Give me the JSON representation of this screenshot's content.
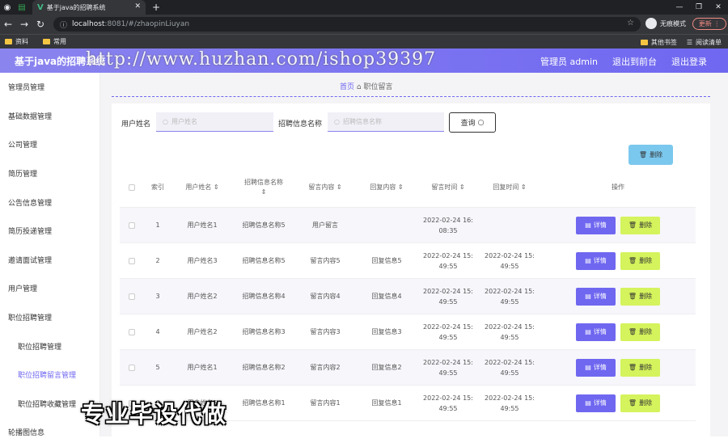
{
  "browser": {
    "tab_title": "基于java的招聘系统",
    "url_host": "localhost",
    "url_path": ":8081/#/zhaopinLiuyan",
    "incognito": "无痕模式",
    "update": "更新",
    "bookmarks": [
      "资料",
      "常用"
    ],
    "bookmarks_right": [
      "其他书签",
      "阅读清单"
    ]
  },
  "header": {
    "title": "基于java的招聘系统",
    "watermark": "http://www.huzhan.com/ishop39397",
    "links": [
      "管理员 admin",
      "退出到前台",
      "退出登录"
    ]
  },
  "sidebar": {
    "items": [
      {
        "label": "管理员管理",
        "sub": false,
        "active": false
      },
      {
        "label": "基础数据管理",
        "sub": false,
        "active": false
      },
      {
        "label": "公司管理",
        "sub": false,
        "active": false
      },
      {
        "label": "简历管理",
        "sub": false,
        "active": false
      },
      {
        "label": "公告信息管理",
        "sub": false,
        "active": false
      },
      {
        "label": "简历投递管理",
        "sub": false,
        "active": false
      },
      {
        "label": "邀请面试管理",
        "sub": false,
        "active": false
      },
      {
        "label": "用户管理",
        "sub": false,
        "active": false
      },
      {
        "label": "职位招聘管理",
        "sub": false,
        "active": false
      },
      {
        "label": "职位招聘管理",
        "sub": true,
        "active": false
      },
      {
        "label": "职位招聘留言管理",
        "sub": true,
        "active": true
      },
      {
        "label": "职位招聘收藏管理",
        "sub": true,
        "active": false
      },
      {
        "label": "轮播图信息",
        "sub": false,
        "active": false
      }
    ]
  },
  "breadcrumb": {
    "home": "首页",
    "current": "职位留言"
  },
  "search": {
    "user_label": "用户姓名",
    "user_placeholder": "用户姓名",
    "job_label": "招聘信息名称",
    "job_placeholder": "招聘信息名称",
    "query": "查询"
  },
  "delete_all": "删除",
  "table": {
    "headers": [
      "索引",
      "用户姓名",
      "招聘信息名称",
      "留言内容",
      "回复内容",
      "留言时间",
      "回复时间",
      "操作"
    ],
    "rows": [
      [
        "1",
        "用户姓名1",
        "招聘信息名称5",
        "用户留言",
        "",
        "2022-02-24 16:08:35",
        ""
      ],
      [
        "2",
        "用户姓名3",
        "招聘信息名称5",
        "留言内容5",
        "回复信息5",
        "2022-02-24 15:49:55",
        "2022-02-24 15:49:55"
      ],
      [
        "3",
        "用户姓名2",
        "招聘信息名称4",
        "留言内容4",
        "回复信息4",
        "2022-02-24 15:49:55",
        "2022-02-24 15:49:55"
      ],
      [
        "4",
        "用户姓名2",
        "招聘信息名称3",
        "留言内容3",
        "回复信息3",
        "2022-02-24 15:49:55",
        "2022-02-24 15:49:55"
      ],
      [
        "5",
        "用户姓名1",
        "招聘信息名称2",
        "留言内容2",
        "回复信息2",
        "2022-02-24 15:49:55",
        "2022-02-24 15:49:55"
      ],
      [
        "6",
        "用户姓名5",
        "招聘信息名称1",
        "留言内容1",
        "回复信息1",
        "2022-02-24 15:49:55",
        "2022-02-24 15:49:55"
      ]
    ],
    "detail_label": "详情",
    "delete_label": "删除"
  },
  "caption": "专业毕设代做"
}
